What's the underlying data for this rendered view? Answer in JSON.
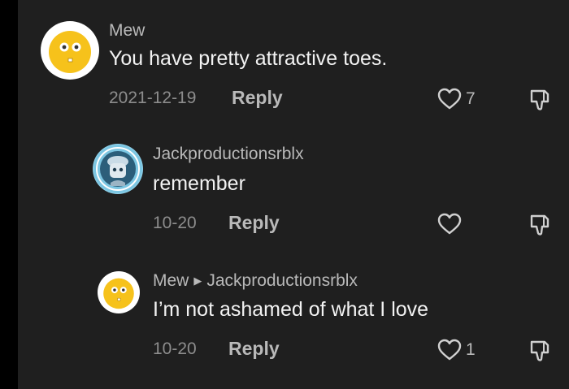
{
  "comments": [
    {
      "author": "Mew",
      "text": "You have pretty attractive toes.",
      "date": "2021-12-19",
      "reply_label": "Reply",
      "likes": "7",
      "avatar": "emoji-face-icon"
    },
    {
      "author": "Jackproductionsrblx",
      "text": "remember",
      "date": "10-20",
      "reply_label": "Reply",
      "likes": "",
      "avatar": "roblox-character-icon"
    },
    {
      "author": "Mew",
      "reply_to": "Jackproductionsrblx",
      "text": "I’m not ashamed of what I love",
      "date": "10-20",
      "reply_label": "Reply",
      "likes": "1",
      "avatar": "emoji-face-icon"
    }
  ],
  "colors": {
    "background": "#1f1f1f",
    "text": "#f2f2f2",
    "muted": "#8d8d8d",
    "accent_avatar": "#f6c21b"
  }
}
